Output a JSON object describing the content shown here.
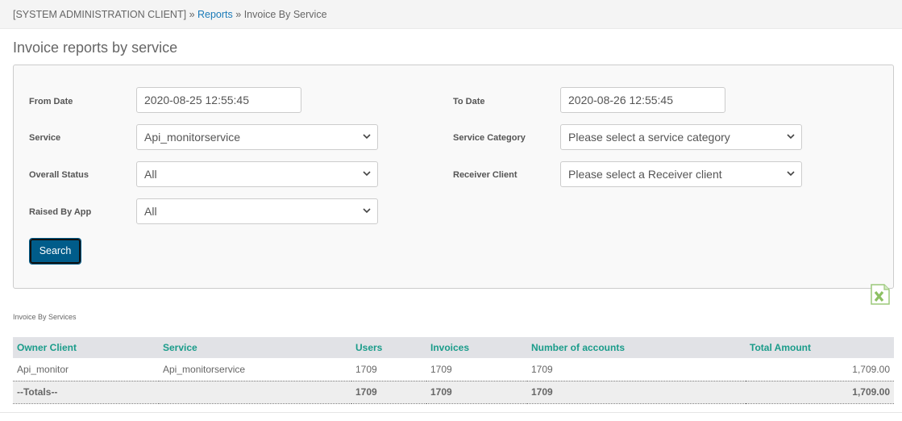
{
  "breadcrumb": {
    "root": "[SYSTEM ADMINISTRATION CLIENT]",
    "sep": "»",
    "reports": "Reports",
    "current": "Invoice By Service"
  },
  "page_title": "Invoice reports by service",
  "form": {
    "from_date": {
      "label": "From Date",
      "value": "2020-08-25 12:55:45"
    },
    "to_date": {
      "label": "To Date",
      "value": "2020-08-26 12:55:45"
    },
    "service": {
      "label": "Service",
      "value": "Api_monitorservice"
    },
    "service_category": {
      "label": "Service Category",
      "value": "Please select a service category"
    },
    "overall_status": {
      "label": "Overall Status",
      "value": "All"
    },
    "receiver_client": {
      "label": "Receiver Client",
      "value": "Please select a Receiver client"
    },
    "raised_by_app": {
      "label": "Raised By App",
      "value": "All"
    },
    "search_label": "Search"
  },
  "export_icon": "excel-icon",
  "table": {
    "caption": "Invoice By Services",
    "headers": [
      "Owner Client",
      "Service",
      "Users",
      "Invoices",
      "Number of accounts",
      "Total Amount"
    ],
    "rows": [
      [
        "Api_monitor",
        "Api_monitorservice",
        "1709",
        "1709",
        "1709",
        "1,709.00"
      ]
    ],
    "totals": [
      "--Totals--",
      "",
      "1709",
      "1709",
      "1709",
      "1,709.00"
    ]
  },
  "colors": {
    "accent": "#005c8a",
    "header_text": "#1a9c8a",
    "link": "#1a7ab8"
  }
}
